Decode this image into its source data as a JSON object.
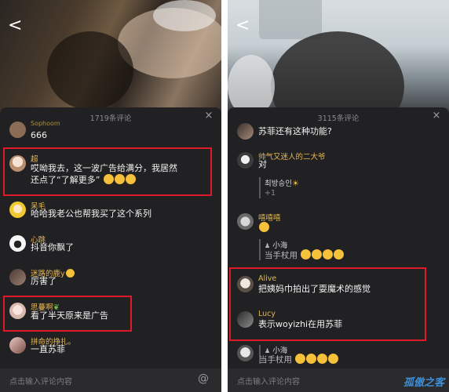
{
  "left": {
    "back_label": "<",
    "comment_count": "1719条评论",
    "close_label": "×",
    "partial_name": "Sophoom",
    "comments": [
      {
        "name": "",
        "text": "666"
      },
      {
        "name": "超",
        "text_line1": "哎呦我去，这一波广告给满分，我居然",
        "text_line2": "还点了“了解更多”"
      },
      {
        "name": "呆毛",
        "text": "哈哈我老公也帮我买了这个系列"
      },
      {
        "name": "心跳",
        "text": "抖音你飘了"
      },
      {
        "name": "迷路的鹿y",
        "text": "厉害了"
      },
      {
        "name": "思蔓啊",
        "text": "看了半天原来是广告"
      },
      {
        "name": "拼命的挣扎。",
        "text": "一直苏菲"
      }
    ],
    "input_placeholder": "点击输入评论内容",
    "at_label": "@"
  },
  "right": {
    "back_label": "<",
    "comment_count": "3115条评论",
    "close_label": "×",
    "comments": [
      {
        "name": "",
        "text": "苏菲还有这种功能?"
      },
      {
        "name": "帅气又迷人的二大爷",
        "text": "对",
        "reply_name": "최방승인",
        "reply_count": "+1"
      },
      {
        "name": "嘻嘻嘻",
        "text": "",
        "reply_name": "小海",
        "reply_text": "当手杖用"
      },
      {
        "name": "Alive",
        "text": "把姨妈巾拍出了耍魔术的感觉"
      },
      {
        "name": "Lucy",
        "text": "表示woyizhi在用苏菲",
        "reply_name": "小海",
        "reply_text": "当手杖用"
      }
    ],
    "input_placeholder": "点击输入评论内容",
    "watermark": "孤傲之客"
  },
  "colors": {
    "highlight": "#e0192a",
    "name": "#e4b650",
    "sheet_bg": "#212123",
    "emoji": "#f5c03a"
  },
  "icons": [
    "back-chevron-icon",
    "close-icon",
    "at-icon",
    "emoji-icon",
    "leaf-icon",
    "sun-icon",
    "profile-icon"
  ]
}
